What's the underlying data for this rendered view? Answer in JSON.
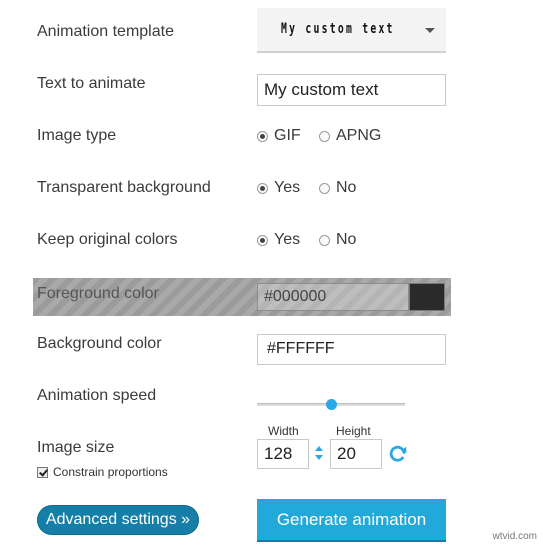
{
  "form": {
    "animation_template": {
      "label": "Animation template",
      "selected_preview": "My custom text"
    },
    "text_to_animate": {
      "label": "Text to animate",
      "value": "My custom text"
    },
    "image_type": {
      "label": "Image type",
      "options": [
        "GIF",
        "APNG"
      ],
      "selected": "GIF"
    },
    "transparent_background": {
      "label": "Transparent background",
      "options": [
        "Yes",
        "No"
      ],
      "selected": "Yes"
    },
    "keep_original_colors": {
      "label": "Keep original colors",
      "options": [
        "Yes",
        "No"
      ],
      "selected": "Yes"
    },
    "foreground_color": {
      "label": "Foreground color",
      "value": "#000000",
      "swatch": "#2a2a2a",
      "disabled": true
    },
    "background_color": {
      "label": "Background color",
      "value": "#FFFFFF"
    },
    "animation_speed": {
      "label": "Animation speed",
      "level": 0.5
    },
    "image_size": {
      "label": "Image size",
      "width_label": "Width",
      "height_label": "Height",
      "width": "128",
      "height": "20",
      "constrain_label": "Constrain proportions",
      "constrain_checked": true
    }
  },
  "buttons": {
    "advanced": "Advanced settings »",
    "generate": "Generate animation"
  },
  "icons": {
    "stepper": "up-down-arrows-icon",
    "refresh": "refresh-icon",
    "dropdown": "caret-down-icon"
  },
  "colors": {
    "accent": "#23a9d9",
    "advanced_button": "#157fa8"
  },
  "watermark": "wtvid.com"
}
